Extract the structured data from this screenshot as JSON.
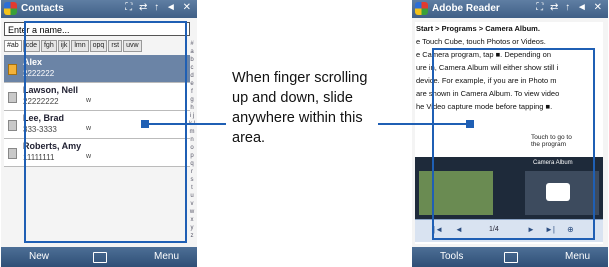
{
  "contacts": {
    "title": "Contacts",
    "status": "⛶ ⇄ ↑ ◄ ✕",
    "name_placeholder": "Enter a name...",
    "tabs": [
      "#ab",
      "cde",
      "fgh",
      "ijk",
      "lmn",
      "opq",
      "rst",
      "uvw"
    ],
    "entries": [
      {
        "name": "Alex",
        "number": "2222222",
        "tag": ""
      },
      {
        "name": "Lawson, Nell",
        "number": "22222222",
        "tag": "w"
      },
      {
        "name": "Lee, Brad",
        "number": "333-3333",
        "tag": "w"
      },
      {
        "name": "Roberts, Amy",
        "number": "11111111",
        "tag": "w"
      }
    ],
    "alpha_index": "# a b c d e f g h i j k l m n o p q r s t u v w x y z",
    "softkeys": {
      "left": "New",
      "right": "Menu"
    }
  },
  "reader": {
    "title": "Adobe Reader",
    "status": "⛶ ⇄ ↑ ◄ ✕",
    "lines": [
      {
        "text": "Start > Programs > Camera Album.",
        "bold": true
      },
      {
        "text": "e Touch Cube, touch Photos or Videos.",
        "bold": false
      },
      {
        "text": "",
        "bold": false
      },
      {
        "text": "e Camera program, tap ■. Depending on",
        "bold": false
      },
      {
        "text": "ure in, Camera Album will either show still i",
        "bold": false
      },
      {
        "text": "device. For example, if you are in Photo m",
        "bold": false
      },
      {
        "text": "are shown in Camera Album. To view video",
        "bold": false
      },
      {
        "text": "he Video capture mode before tapping ■.",
        "bold": false
      }
    ],
    "callout": "Touch to go to the program",
    "mini_label": "Camera Album",
    "page": "1/4",
    "softkeys": {
      "left": "Tools",
      "right": "Menu"
    }
  },
  "caption": "When finger scrolling up and down, slide anywhere within this area."
}
